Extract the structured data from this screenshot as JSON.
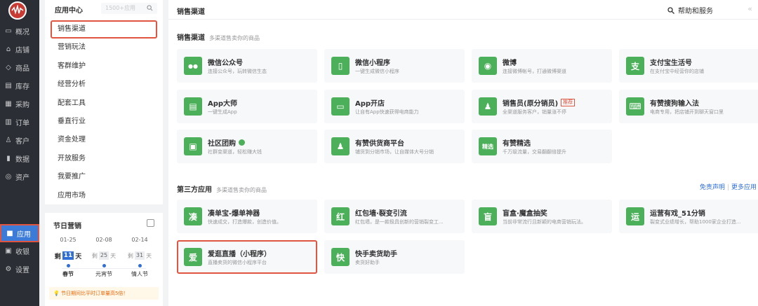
{
  "nav": {
    "items": [
      {
        "label": "概况",
        "icon": "chat-icon"
      },
      {
        "label": "店铺",
        "icon": "store-icon"
      },
      {
        "label": "商品",
        "icon": "tag-icon"
      },
      {
        "label": "库存",
        "icon": "inventory-icon"
      },
      {
        "label": "采购",
        "icon": "purchase-icon"
      },
      {
        "label": "订单",
        "icon": "order-icon"
      },
      {
        "label": "客户",
        "icon": "customer-icon"
      },
      {
        "label": "数据",
        "icon": "chart-icon"
      },
      {
        "label": "资产",
        "icon": "asset-icon"
      },
      {
        "label": "应用",
        "icon": "apps-icon"
      },
      {
        "label": "收银",
        "icon": "cashier-icon"
      },
      {
        "label": "设置",
        "icon": "gear-icon"
      }
    ]
  },
  "sub": {
    "title": "应用中心",
    "search_placeholder": "1500+应用",
    "items": [
      "销售渠道",
      "营销玩法",
      "客群维护",
      "经营分析",
      "配套工具",
      "垂直行业",
      "资金处理",
      "开放服务",
      "我要推广",
      "应用市场"
    ]
  },
  "holiday": {
    "title": "节日营销",
    "cols": [
      {
        "date": "01-25",
        "prefix": "剩",
        "days": "11",
        "unit": "天",
        "name": "春节"
      },
      {
        "date": "02-08",
        "prefix": "剩",
        "days": "25",
        "unit": "天",
        "name": "元宵节"
      },
      {
        "date": "02-14",
        "prefix": "剩",
        "days": "31",
        "unit": "天",
        "name": "情人节"
      }
    ],
    "tip": "💡 节日期间比平时订单量高5倍！"
  },
  "topbar": {
    "title": "销售渠道",
    "help": "帮助和服务",
    "collapse": "«"
  },
  "sections": {
    "sales": {
      "title": "销售渠道",
      "desc": "多渠道售卖你的商品"
    },
    "third": {
      "title": "第三方应用",
      "desc": "多渠道售卖你的商品",
      "link1": "免责声明",
      "link2": "更多应用"
    }
  },
  "sales_cards": [
    {
      "title": "微信公众号",
      "desc": "连接公众号，玩转微信生态",
      "icon": "wechat-icon",
      "glyph": "●●",
      "color": "#4caf5a"
    },
    {
      "title": "微信小程序",
      "desc": "一键生成微信小程序",
      "icon": "miniprogram-icon",
      "glyph": "▯",
      "color": "#4caf5a"
    },
    {
      "title": "微博",
      "desc": "连接微博帐号，打通微博渠道",
      "icon": "weibo-icon",
      "glyph": "◉",
      "color": "#4caf5a"
    },
    {
      "title": "支付宝生活号",
      "desc": "在支付宝中经营你的店铺",
      "icon": "alipay-icon",
      "glyph": "支",
      "color": "#4caf5a"
    },
    {
      "title": "App大师",
      "desc": "一键生成App",
      "icon": "app-master-icon",
      "glyph": "▤",
      "color": "#4caf5a"
    },
    {
      "title": "App开店",
      "desc": "让自有App快速获得电商能力",
      "icon": "app-store-icon",
      "glyph": "▭",
      "color": "#4caf5a"
    },
    {
      "title": "销售员(原分销员)",
      "desc": "全渠道服务客户，销量涨不停",
      "icon": "salesperson-icon",
      "glyph": "♟",
      "color": "#4caf5a",
      "tag": "推荐"
    },
    {
      "title": "有赞搜狗输入法",
      "desc": "电商专用，把店铺开到聊天窗口里",
      "icon": "keyboard-icon",
      "glyph": "⌨",
      "color": "#4caf5a"
    },
    {
      "title": "社区团购",
      "desc": "社群变渠道，轻松赚大钱",
      "icon": "group-buy-icon",
      "glyph": "▣",
      "color": "#4caf5a",
      "verified": true
    },
    {
      "title": "有赞供货商平台",
      "desc": "铺货到分销市场，让自媒体大号分销",
      "icon": "supplier-icon",
      "glyph": "♟",
      "color": "#4caf5a"
    },
    {
      "title": "有赞精选",
      "desc": "千万级流量，交易翻翻倍提升",
      "icon": "selection-icon",
      "glyph": "精选",
      "color": "#4caf5a"
    }
  ],
  "third_cards": [
    {
      "title": "凑单宝-爆单神器",
      "desc": "快速成交，打造爆款，创造价值。",
      "icon": "coudanbao-icon",
      "glyph": "凑",
      "color": "#4caf5a"
    },
    {
      "title": "红包墙·裂变引流",
      "desc": "红包墙，是一款极具创新的营销裂变工...",
      "icon": "redpacket-icon",
      "glyph": "红",
      "color": "#4caf5a"
    },
    {
      "title": "盲盒·魔盒抽奖",
      "desc": "当前非常流行且新颖的电商营销玩法。",
      "icon": "blindbox-icon",
      "glyph": "盲",
      "color": "#4caf5a"
    },
    {
      "title": "运营有戏_51分销",
      "desc": "裂变式业绩增长，帮助1000家企业打造...",
      "icon": "yunying-icon",
      "glyph": "运",
      "color": "#4caf5a"
    },
    {
      "title": "爱逛直播（小程序）",
      "desc": "直播卖货的微信小程序平台",
      "icon": "aiguang-icon",
      "glyph": "爱",
      "color": "#4caf5a"
    },
    {
      "title": "快手卖货助手",
      "desc": "卖货好助手",
      "icon": "kuaishou-icon",
      "glyph": "快",
      "color": "#4caf5a"
    }
  ]
}
